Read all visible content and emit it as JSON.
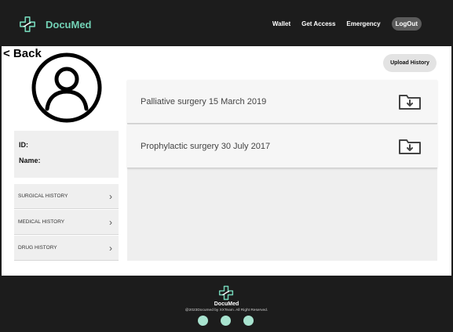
{
  "brand": {
    "name": "DocuMed",
    "logo_icon": "medical-cross-icon",
    "accent": "#72d1b5"
  },
  "nav": {
    "wallet": "Wallet",
    "get_access": "Get Access",
    "emergency": "Emergency",
    "logout": "LogOut"
  },
  "back_label": "< Back",
  "upload_label": "Upload History",
  "profile": {
    "id_label": "ID:",
    "name_label": "Name:"
  },
  "menu": [
    {
      "label": "SURGICAL HISTORY"
    },
    {
      "label": "MEDICAL HISTORY"
    },
    {
      "label": "DRUG HISTORY"
    }
  ],
  "records": [
    {
      "title": "Palliative surgery 15 March 2019",
      "icon": "folder-download-icon"
    },
    {
      "title": "Prophylactic surgery 30 July 2017",
      "icon": "folder-download-icon"
    }
  ],
  "footer": {
    "name": "DocuMed",
    "copyright": "@2023Documed by XXTeam. All Right Reserved.",
    "social_color": "#a8e3cf"
  }
}
